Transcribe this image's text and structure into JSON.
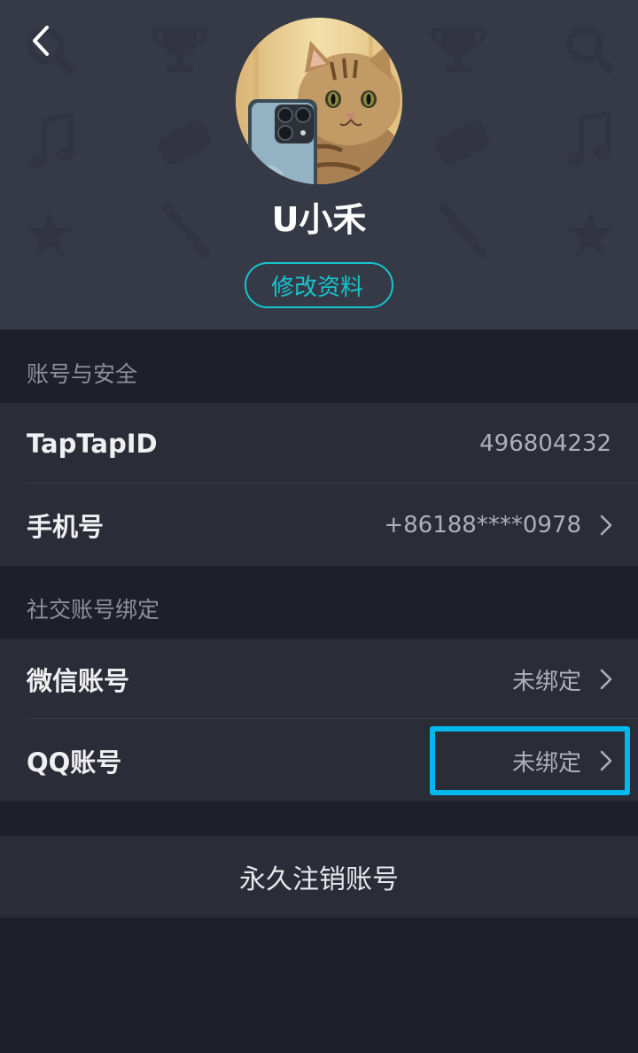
{
  "header": {
    "back_icon": "chevron-left-icon",
    "username": "U小禾",
    "edit_profile_label": "修改资料",
    "accent_color": "#15c5ce"
  },
  "account_security": {
    "title": "账号与安全",
    "rows": [
      {
        "label": "TapTapID",
        "value": "496804232"
      },
      {
        "label": "手机号",
        "value": "+86188****0978"
      }
    ]
  },
  "social_binding": {
    "title": "社交账号绑定",
    "rows": [
      {
        "label": "微信账号",
        "value": "未绑定"
      },
      {
        "label": "QQ账号",
        "value": "未绑定"
      }
    ]
  },
  "delete_account_label": "永久注销账号",
  "highlight_color": "#00b8ec"
}
